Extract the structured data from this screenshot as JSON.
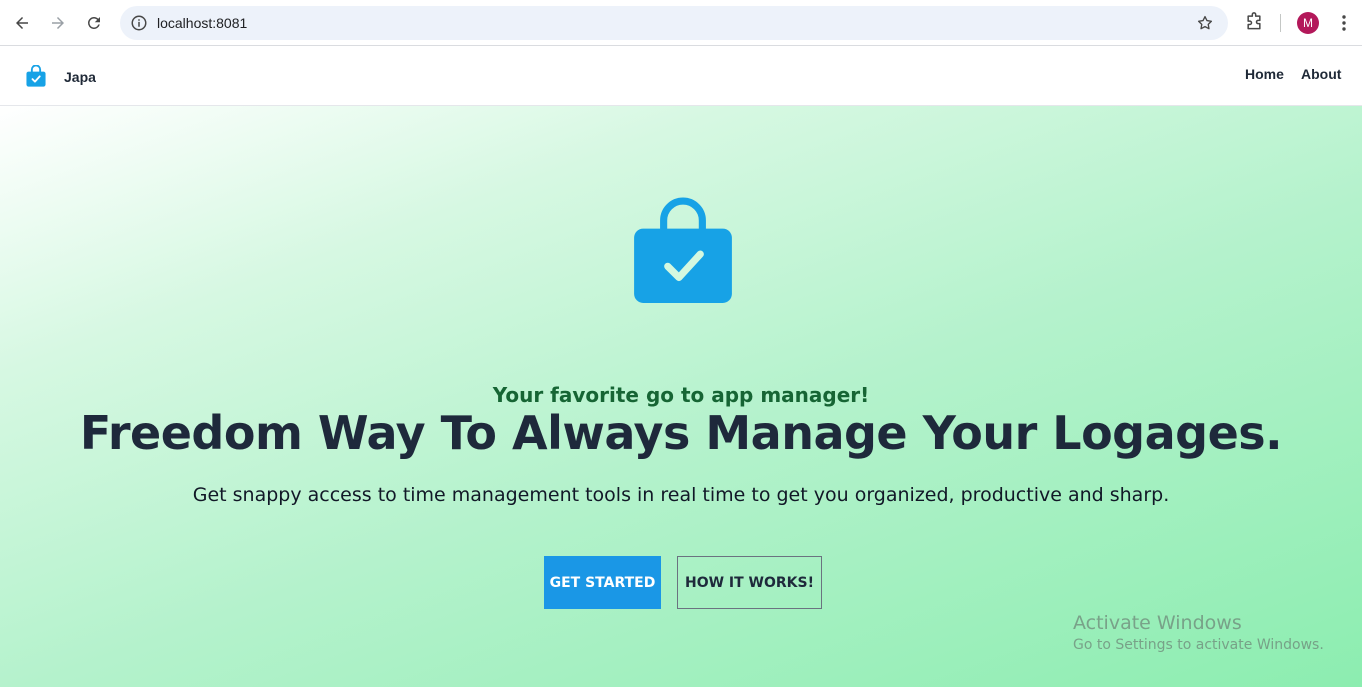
{
  "browser": {
    "url": "localhost:8081",
    "profile_initial": "M",
    "profile_color": "#b3185a"
  },
  "header": {
    "brand_name": "Japa",
    "nav": {
      "home_label": "Home",
      "about_label": "About"
    }
  },
  "hero": {
    "tagline": "Your favorite go to app manager!",
    "headline": "Freedom Way To Always Manage Your Logages.",
    "subtext": "Get snappy access to time management tools in real time to get you organized, productive and sharp.",
    "primary_button": "GET STARTED",
    "secondary_button": "HOW IT WORKS!"
  },
  "watermark": {
    "title": "Activate Windows",
    "subtitle": "Go to Settings to activate Windows."
  },
  "colors": {
    "accent": "#1a97e6",
    "tagline": "#166534",
    "headline": "#1e293b"
  },
  "icons": [
    "back-arrow-icon",
    "forward-arrow-icon",
    "reload-icon",
    "site-info-icon",
    "bookmark-star-icon",
    "extensions-icon",
    "more-options-icon",
    "shopping-bag-check-icon"
  ]
}
